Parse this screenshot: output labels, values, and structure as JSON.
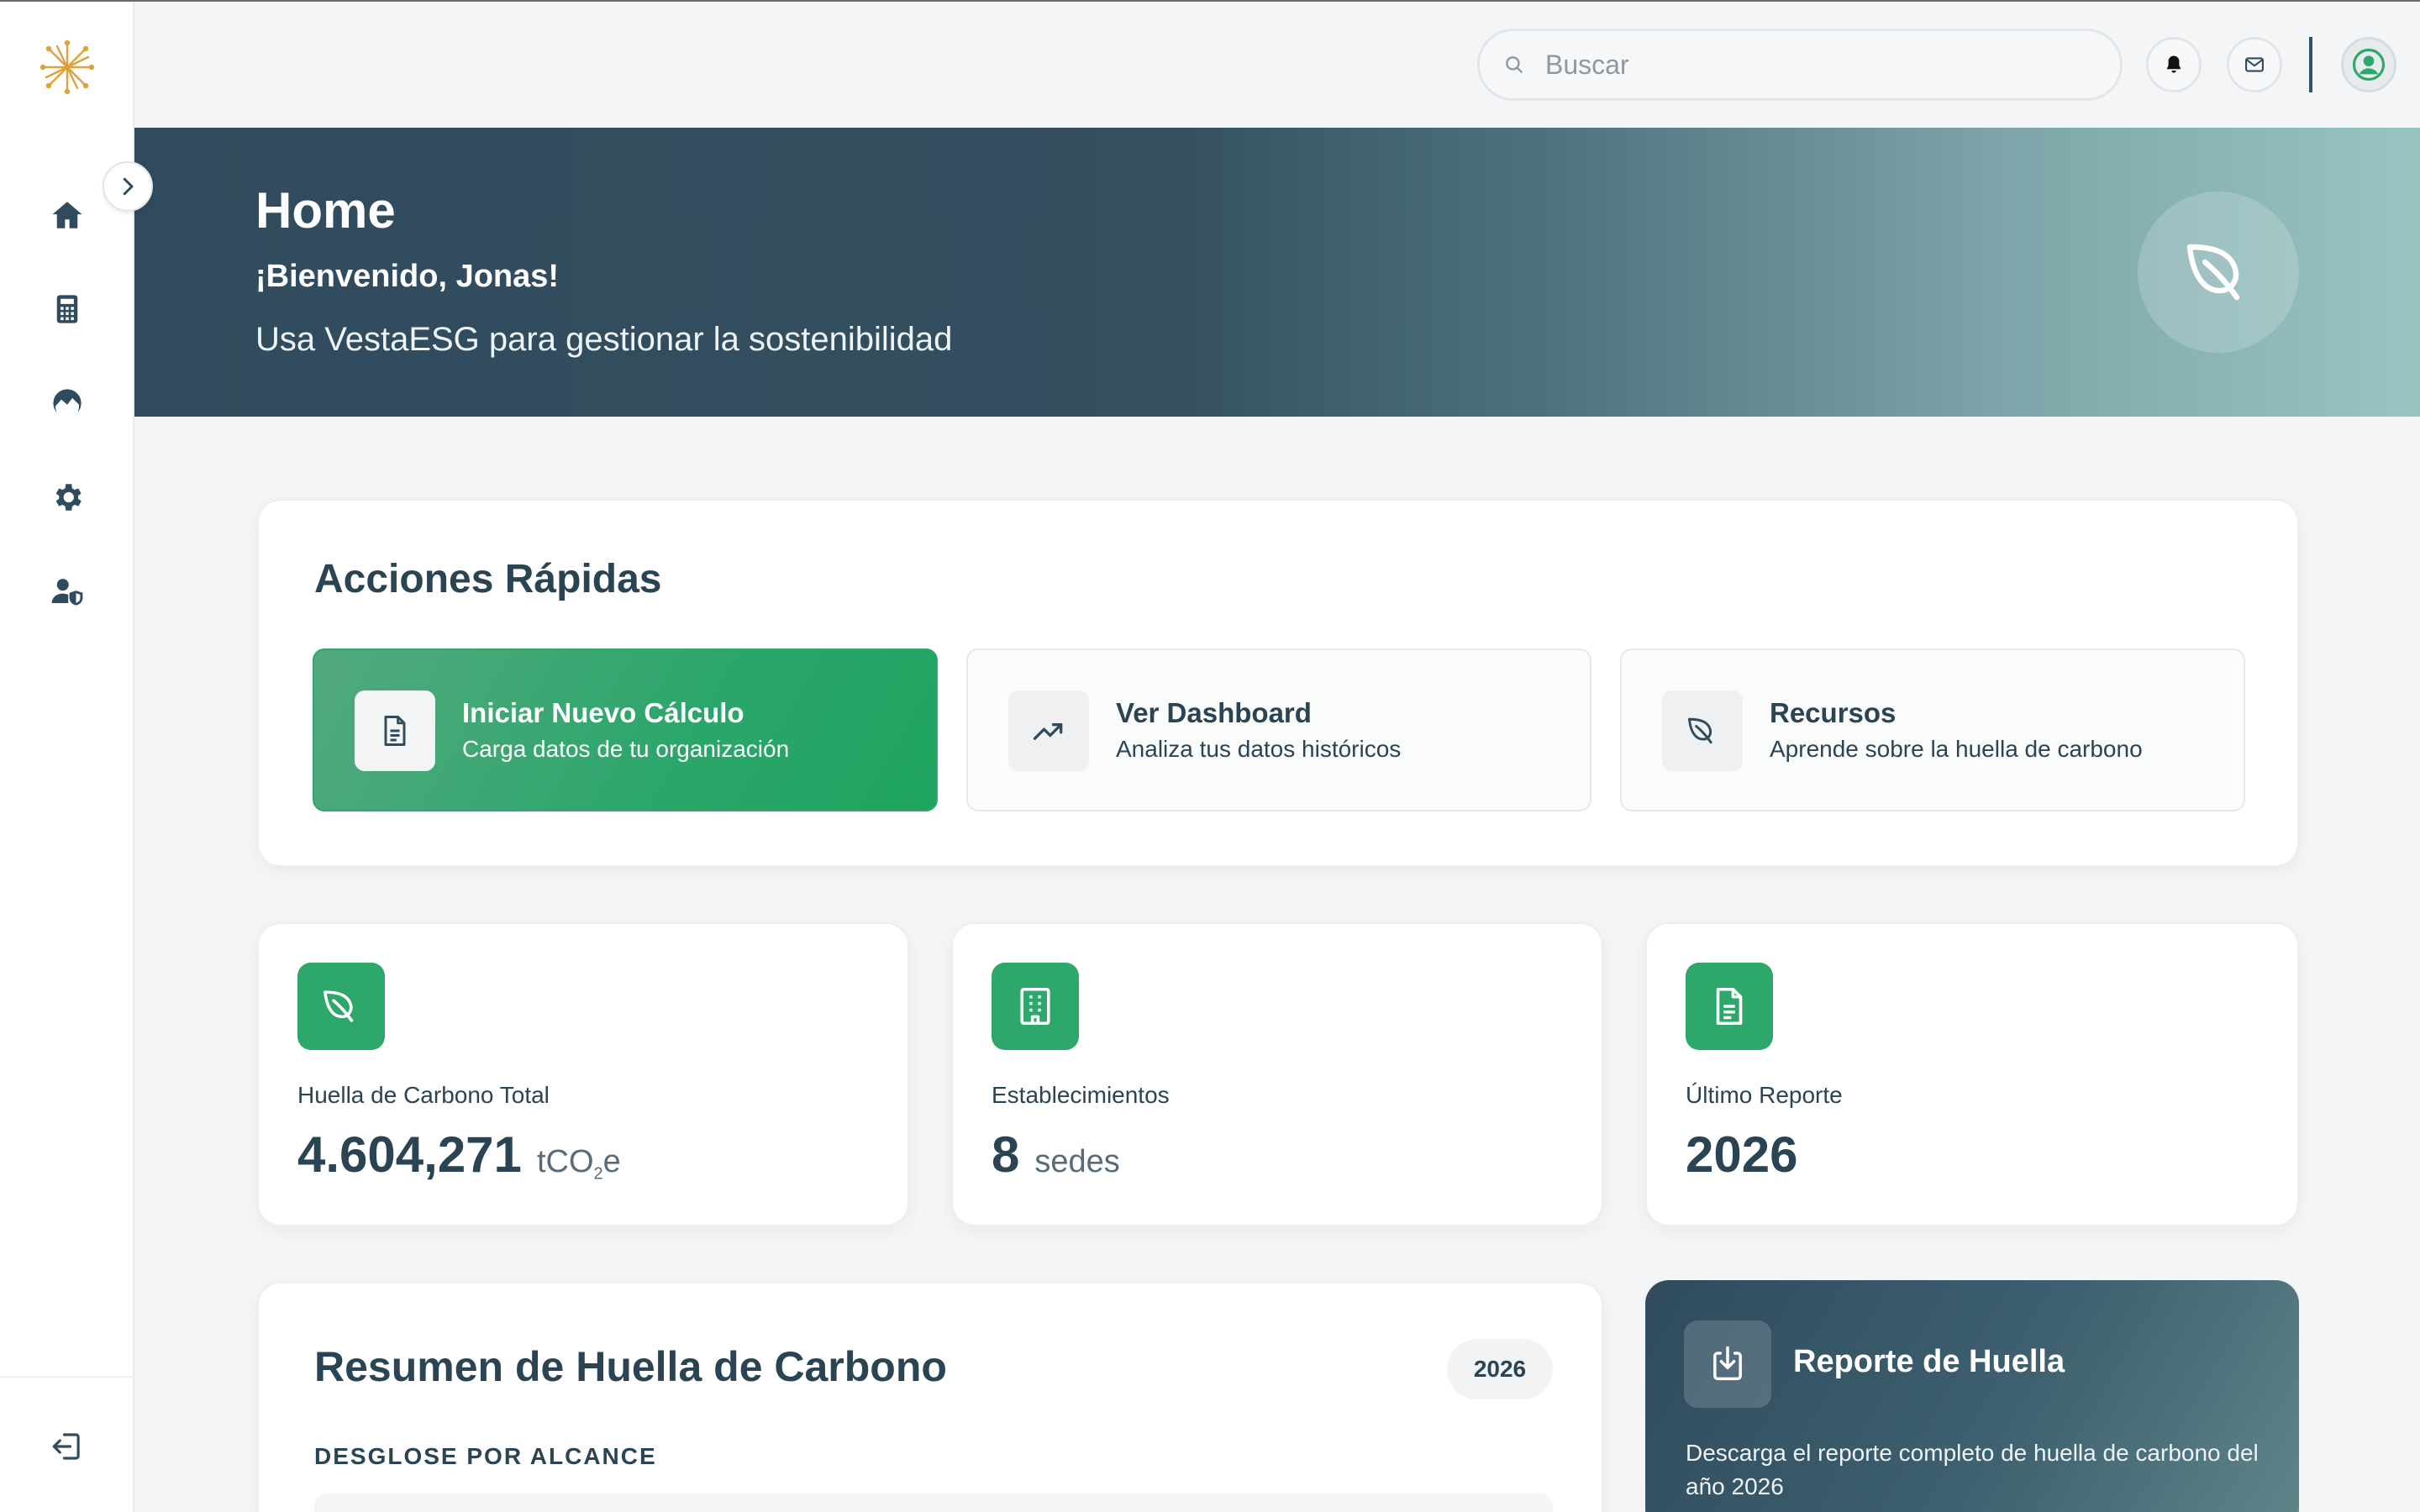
{
  "header": {
    "search_placeholder": "Buscar"
  },
  "sidebar": {
    "items": [
      {
        "icon": "home-icon"
      },
      {
        "icon": "calculator-icon"
      },
      {
        "icon": "chart-icon"
      },
      {
        "icon": "gear-icon"
      },
      {
        "icon": "user-shield-icon"
      }
    ],
    "logout_icon": "logout-icon"
  },
  "hero": {
    "title": "Home",
    "welcome": "¡Bienvenido, Jonas!",
    "subtitle": "Usa VestaESG para gestionar la sostenibilidad"
  },
  "quick_actions": {
    "title": "Acciones Rápidas",
    "items": [
      {
        "label": "Iniciar Nuevo Cálculo",
        "desc": "Carga datos de tu organización",
        "icon": "document-icon"
      },
      {
        "label": "Ver Dashboard",
        "desc": "Analiza tus datos históricos",
        "icon": "trend-up-icon"
      },
      {
        "label": "Recursos",
        "desc": "Aprende sobre la huella de carbono",
        "icon": "leaf-icon"
      }
    ]
  },
  "stats": [
    {
      "label": "Huella de Carbono Total",
      "value": "4.604,271",
      "unit_main": "tCO",
      "unit_sub": "2",
      "unit_end": "e",
      "icon": "leaf-icon"
    },
    {
      "label": "Establecimientos",
      "value": "8",
      "unit": "sedes",
      "icon": "building-icon"
    },
    {
      "label": "Último Reporte",
      "value": "2026",
      "icon": "document-icon"
    }
  ],
  "summary": {
    "title": "Resumen de Huella de Carbono",
    "year": "2026",
    "subtitle": "DESGLOSE POR ALCANCE"
  },
  "report": {
    "title": "Reporte de Huella",
    "desc": "Descarga el reporte completo de huella de carbono del año 2026",
    "icon": "download-icon"
  },
  "colors": {
    "primary_green": "#2ea76a",
    "dark_teal": "#2f4b5d",
    "text": "#2b4453",
    "logo_orange": "#e0a13a"
  }
}
